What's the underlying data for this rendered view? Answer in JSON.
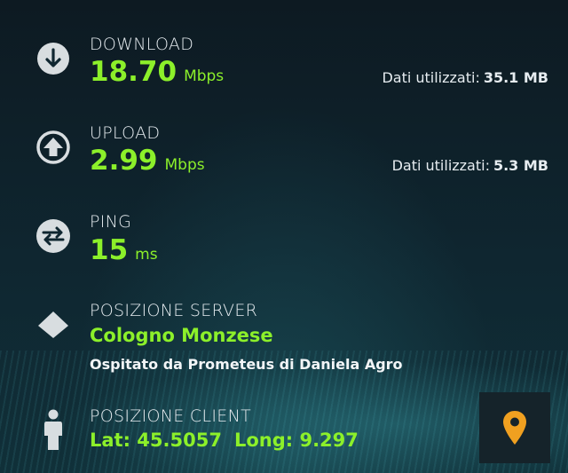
{
  "download": {
    "label": "DOWNLOAD",
    "value": "18.70",
    "unit": "Mbps",
    "data_label": "Dati utilizzati:",
    "data_value": "35.1 MB"
  },
  "upload": {
    "label": "UPLOAD",
    "value": "2.99",
    "unit": "Mbps",
    "data_label": "Dati utilizzati:",
    "data_value": "5.3 MB"
  },
  "ping": {
    "label": "PING",
    "value": "15",
    "unit": "ms"
  },
  "server": {
    "label": "POSIZIONE SERVER",
    "name": "Cologno Monzese",
    "hosted_by": "Ospitato da Prometeus di Daniela Agro"
  },
  "client": {
    "label": "POSIZIONE CLIENT",
    "lat": "Lat: 45.5057",
    "long": "Long: 9.297"
  },
  "icons": {
    "download": "download-icon",
    "upload": "upload-icon",
    "ping": "ping-icon",
    "server": "server-icon",
    "client": "person-icon",
    "map": "map-pin-icon"
  },
  "colors": {
    "accent_green": "#8cf02a",
    "pin_orange": "#f0a020",
    "text": "#e6ecf0"
  }
}
